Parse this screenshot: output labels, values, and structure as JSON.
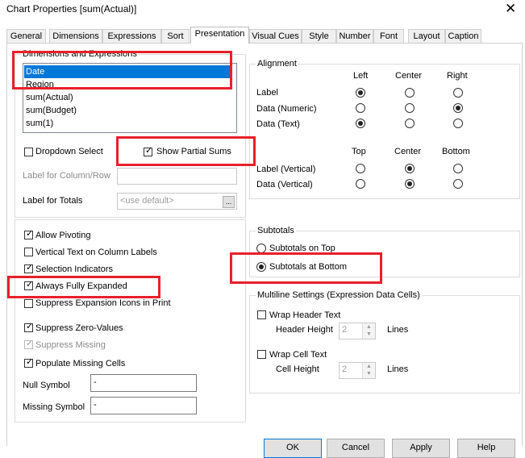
{
  "window": {
    "title": "Chart Properties [sum(Actual)]",
    "close_glyph": "✕"
  },
  "tabs": [
    "General",
    "Dimensions",
    "Expressions",
    "Sort",
    "Presentation",
    "Visual Cues",
    "Style",
    "Number",
    "Font",
    "Layout",
    "Caption"
  ],
  "active_tab": "Presentation",
  "dims_expr": {
    "title": "Dimensions and Expressions",
    "items": [
      "Date",
      "Region",
      "sum(Actual)",
      "sum(Budget)",
      "sum(1)"
    ],
    "selected": "Date"
  },
  "dropdown_select": {
    "label": "Dropdown Select",
    "checked": false
  },
  "show_partial_sums": {
    "label": "Show Partial Sums",
    "checked": true
  },
  "label_col_row": {
    "label": "Label for Column/Row",
    "value": ""
  },
  "label_totals": {
    "label": "Label for Totals",
    "placeholder": "<use default>",
    "button": "..."
  },
  "alignment": {
    "title": "Alignment",
    "col_headers": [
      "Left",
      "Center",
      "Right"
    ],
    "rows": [
      {
        "label": "Label",
        "selected": "Left"
      },
      {
        "label": "Data (Numeric)",
        "selected": "Right"
      },
      {
        "label": "Data (Text)",
        "selected": "Left"
      }
    ],
    "vcol_headers": [
      "Top",
      "Center",
      "Bottom"
    ],
    "vrows": [
      {
        "label": "Label (Vertical)",
        "selected": "Center"
      },
      {
        "label": "Data (Vertical)",
        "selected": "Center"
      }
    ]
  },
  "options": [
    {
      "label": "Allow Pivoting",
      "checked": true,
      "disabled": false
    },
    {
      "label": "Vertical Text on Column Labels",
      "checked": false,
      "disabled": false
    },
    {
      "label": "Selection Indicators",
      "checked": true,
      "disabled": false
    },
    {
      "label": "Always Fully Expanded",
      "checked": true,
      "disabled": false
    },
    {
      "label": "Suppress Expansion Icons in Print",
      "checked": false,
      "disabled": false
    },
    {
      "label": "Suppress Zero-Values",
      "checked": true,
      "disabled": false
    },
    {
      "label": "Suppress Missing",
      "checked": true,
      "disabled": true
    },
    {
      "label": "Populate Missing Cells",
      "checked": true,
      "disabled": false
    }
  ],
  "null_symbol": {
    "label": "Null Symbol",
    "value": "-"
  },
  "missing_symbol": {
    "label": "Missing Symbol",
    "value": "-"
  },
  "subtotals": {
    "title": "Subtotals",
    "on_top": "Subtotals on Top",
    "at_bottom": "Subtotals at Bottom",
    "selected": "at_bottom"
  },
  "multiline": {
    "title": "Multiline Settings (Expression Data Cells)",
    "wrap_header": {
      "label": "Wrap Header Text",
      "checked": false
    },
    "header_height": {
      "label": "Header Height",
      "value": "2",
      "unit": "Lines"
    },
    "wrap_cell": {
      "label": "Wrap Cell Text",
      "checked": false
    },
    "cell_height": {
      "label": "Cell Height",
      "value": "2",
      "unit": "Lines"
    }
  },
  "buttons": [
    "OK",
    "Cancel",
    "Apply",
    "Help"
  ],
  "highlight_color": "#e8202a",
  "selection_color": "#0078d7"
}
